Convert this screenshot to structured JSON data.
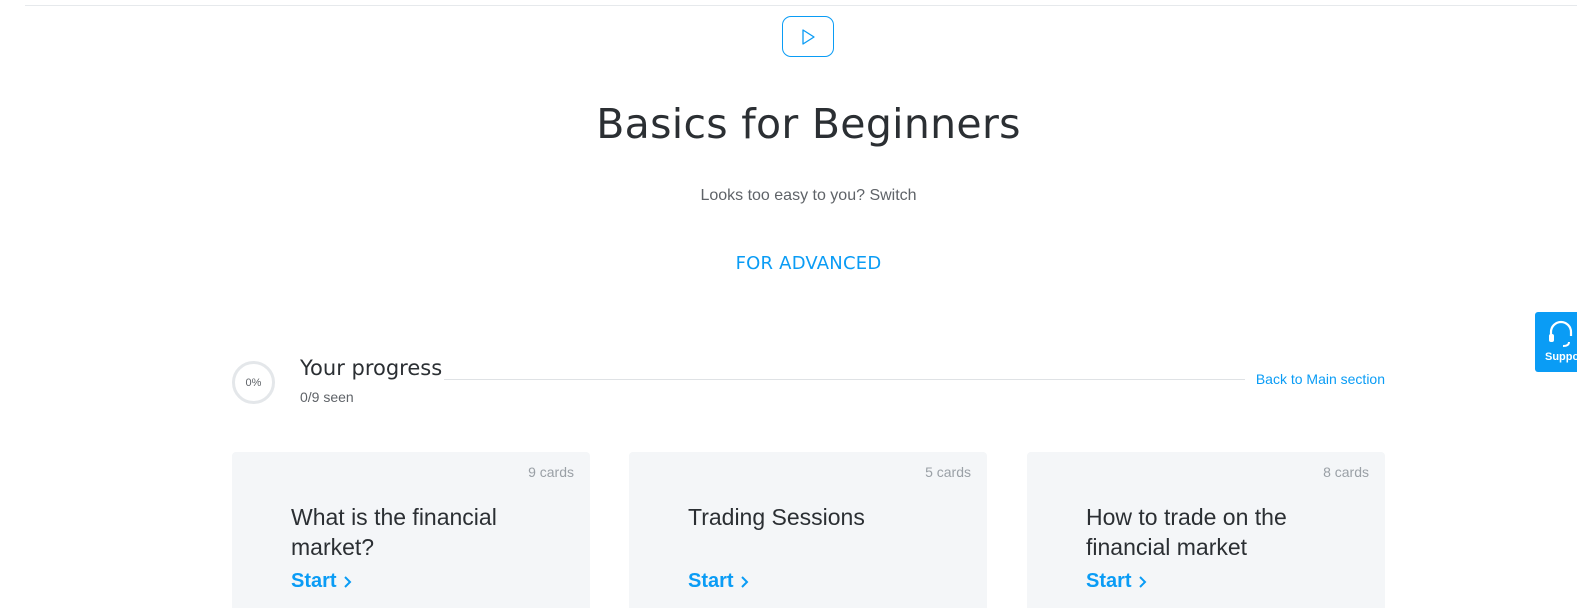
{
  "header": {
    "play_icon": "play-icon"
  },
  "hero": {
    "title": "Basics for Beginners",
    "subtitle": "Looks too easy to you? Switch",
    "advanced_link": "FOR ADVANCED"
  },
  "progress": {
    "percent_label": "0%",
    "percent_value": 0,
    "title": "Your progress",
    "seen": "0/9 seen",
    "back_link": "Back to Main section"
  },
  "cards": [
    {
      "count": "9 cards",
      "title": "What is the financial market?",
      "start": "Start"
    },
    {
      "count": "5 cards",
      "title": "Trading Sessions",
      "start": "Start"
    },
    {
      "count": "8 cards",
      "title": "How to trade on the financial market",
      "start": "Start"
    }
  ],
  "support": {
    "label": "Support",
    "icon": "headset-icon"
  },
  "colors": {
    "accent": "#0a9cf5",
    "text": "#2b2f33",
    "muted": "#5f6368",
    "card_bg": "#f4f6f8"
  }
}
